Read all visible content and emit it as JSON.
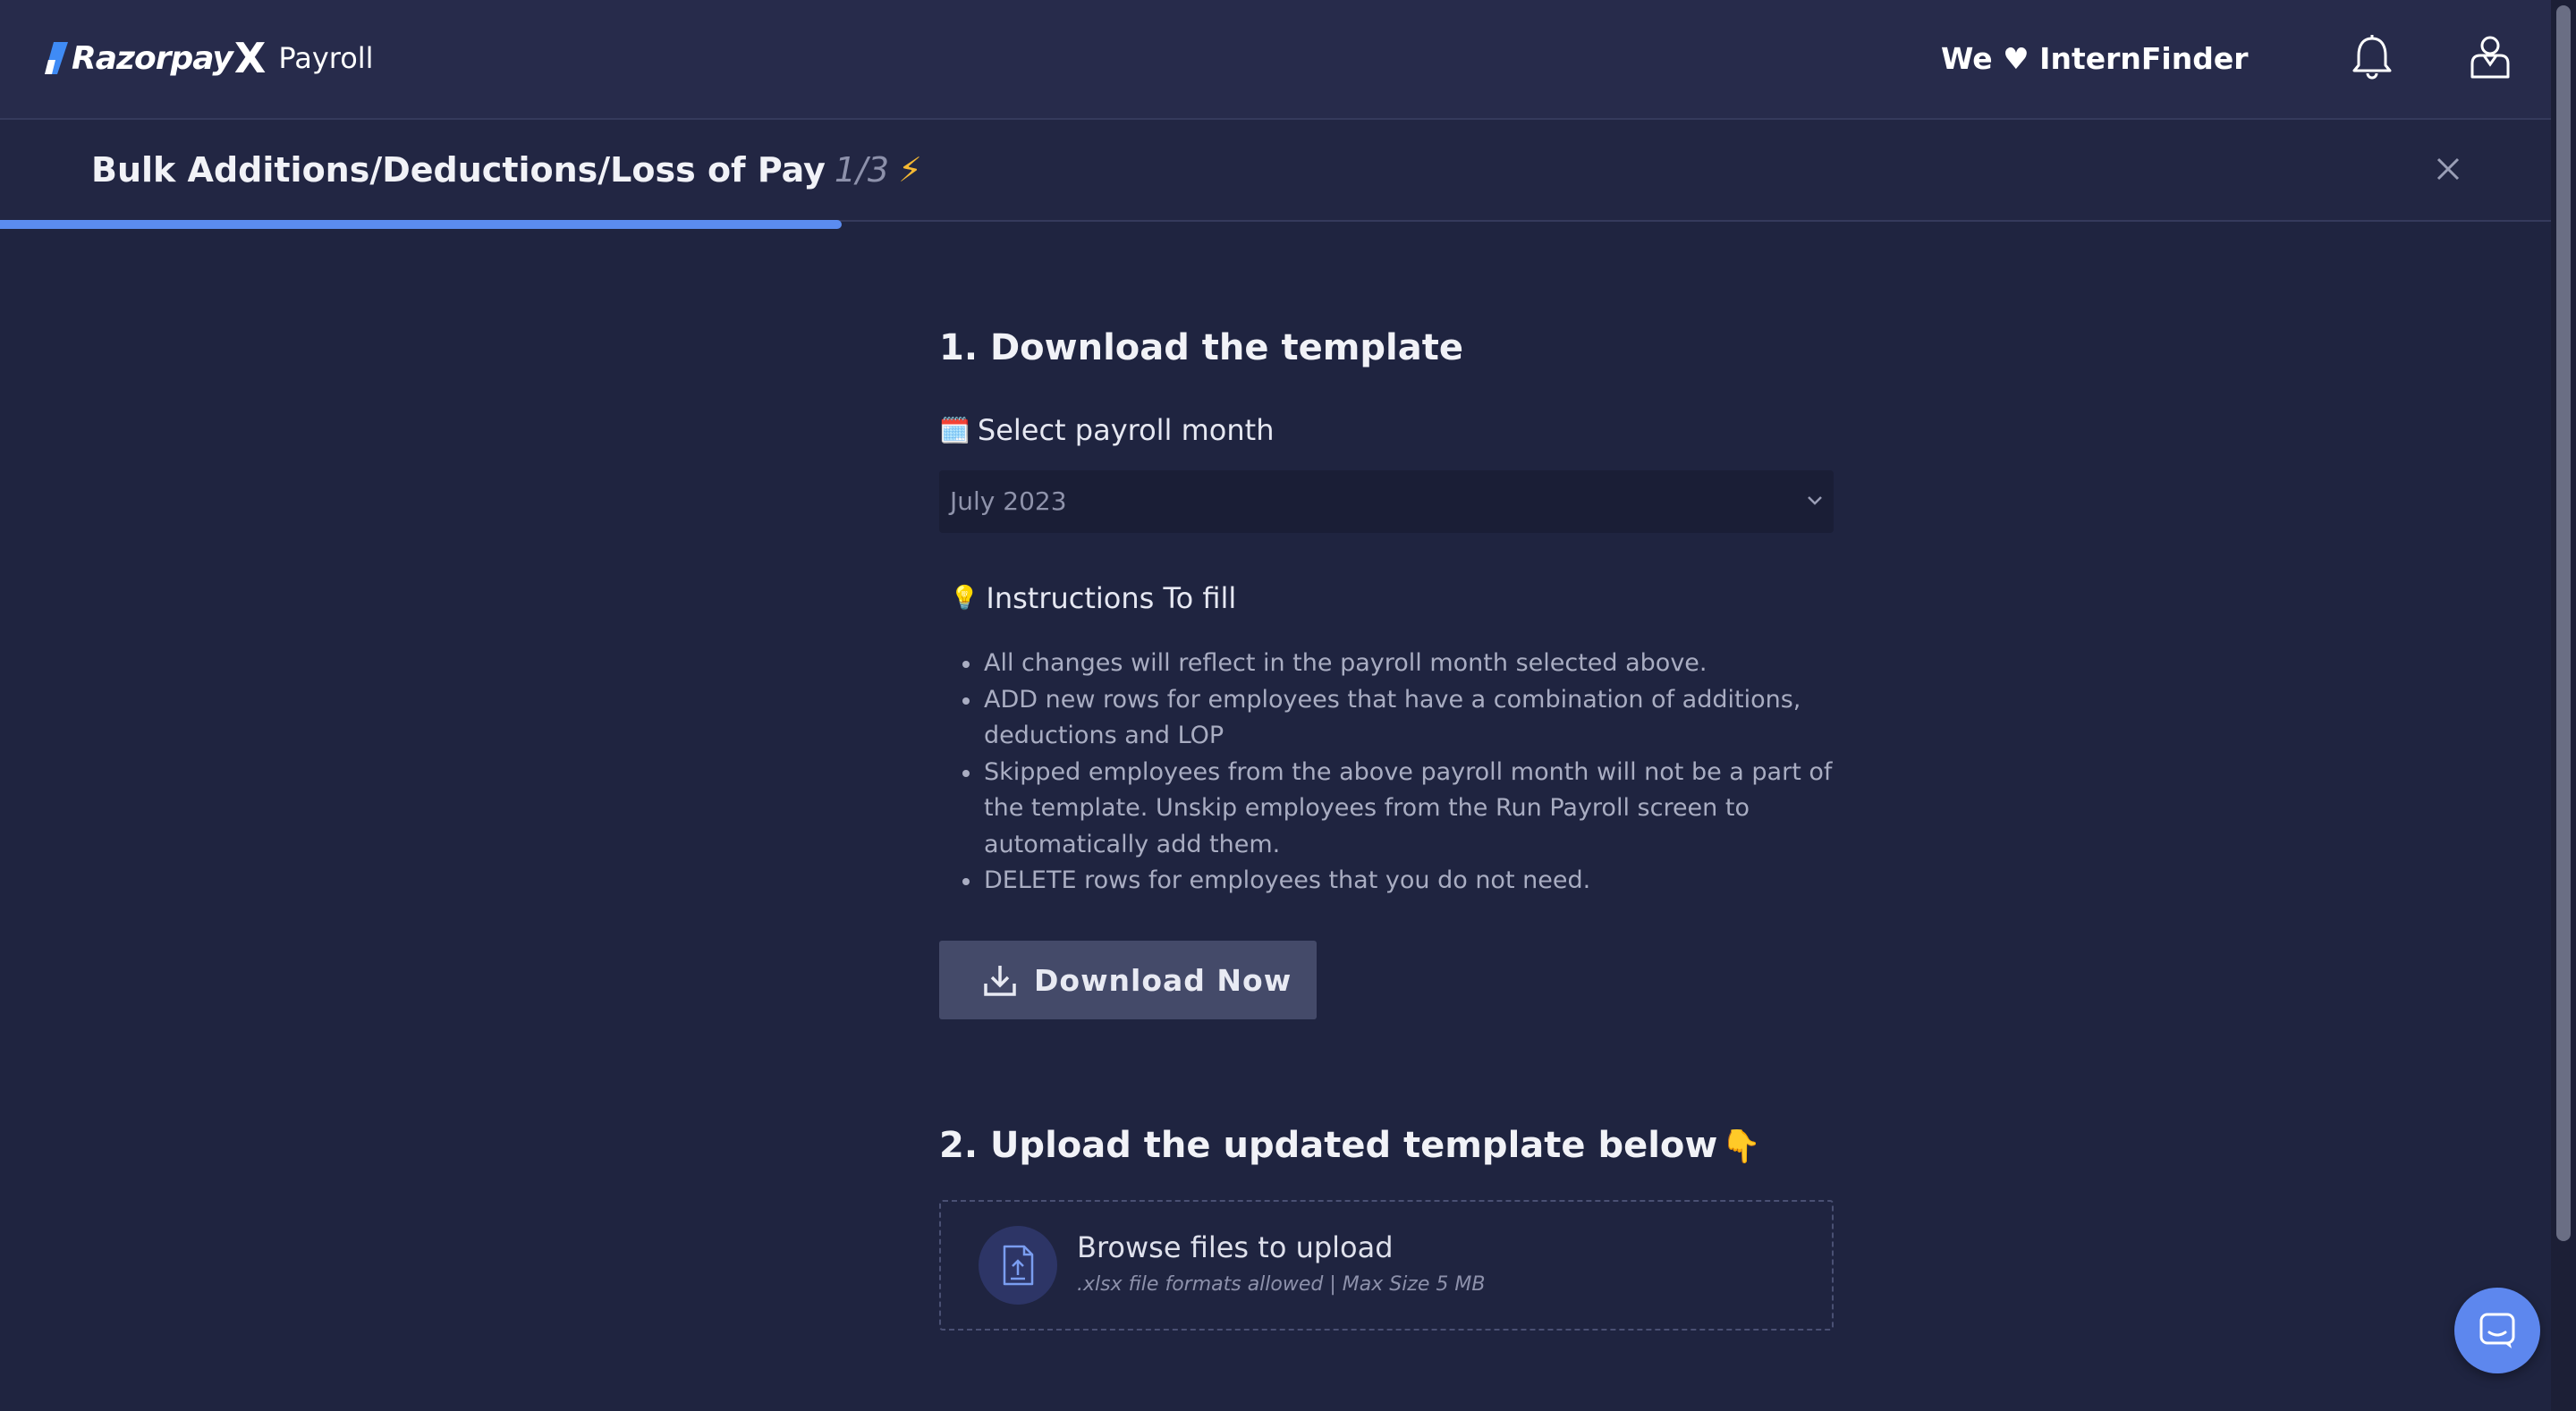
{
  "header": {
    "brand_name": "Razorpay",
    "brand_x": "X",
    "product": "Payroll",
    "company": "We ♥ InternFinder",
    "icons": [
      "bell-icon",
      "user-icon"
    ]
  },
  "subheader": {
    "title": "Bulk Additions/Deductions/Loss of Pay",
    "step": "1/3",
    "bolt": "⚡",
    "progress_fraction": 0.33
  },
  "step1": {
    "heading": "1. Download the template",
    "month_label": "Select payroll month",
    "month_emoji": "🗓️",
    "selected_month": "July 2023",
    "instructions_label": "Instructions To fill",
    "instructions_emoji": "💡",
    "instructions": [
      "All changes will reflect in the payroll month selected above.",
      "ADD new rows for employees that have a combination of additions, deductions and LOP",
      "Skipped employees from the above payroll month will not be a part of the template. Unskip employees from the Run Payroll screen to automatically add them.",
      "DELETE rows for employees that you do not need."
    ],
    "download_label": "Download Now"
  },
  "step2": {
    "heading": "2. Upload the updated template below",
    "heading_emoji": "👇",
    "upload_title": "Browse files to upload",
    "upload_hint": ".xlsx file formats allowed | Max Size 5 MB"
  },
  "colors": {
    "background": "#1f2440",
    "topbar": "#272b4b",
    "accent": "#5b8cf0",
    "button": "#444a69"
  }
}
